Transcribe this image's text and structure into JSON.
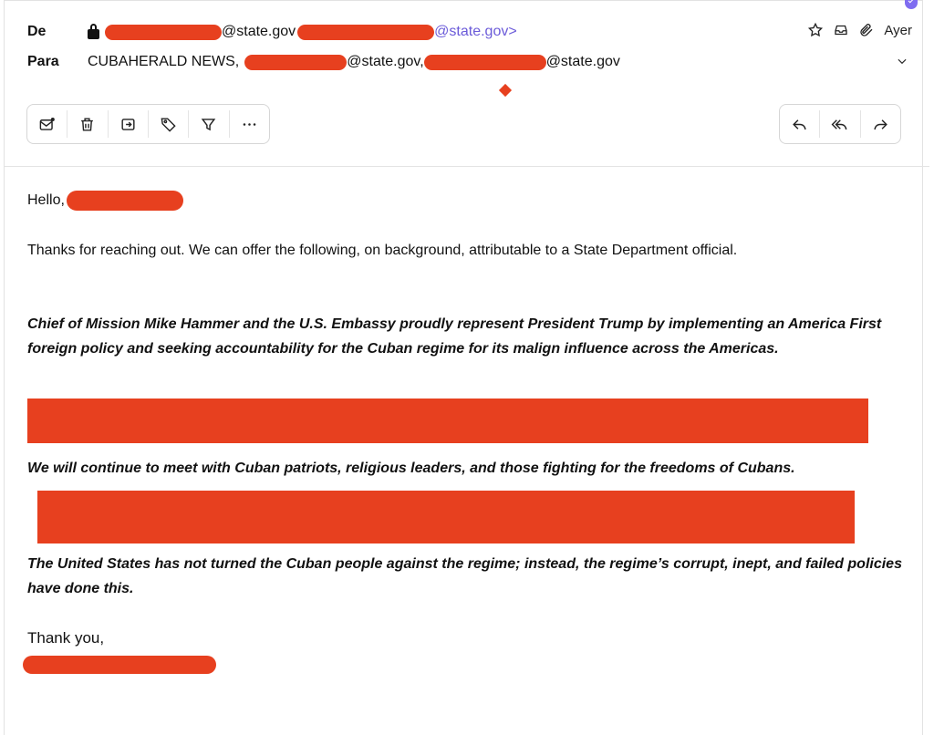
{
  "header": {
    "from_label": "De",
    "from_addr_domain": "@state.gov",
    "from_addr_link": "@state.gov>",
    "to_label": "Para",
    "to_first": "CUBAHERALD NEWS,",
    "to_addr2": "@state.gov,",
    "to_addr3": "@state.gov",
    "date": "Ayer"
  },
  "toolbar": {
    "left_actions": [
      "mark-unread",
      "delete",
      "move",
      "label",
      "filter",
      "more"
    ],
    "right_actions": [
      "reply",
      "reply-all",
      "forward"
    ]
  },
  "message": {
    "greeting": "Hello,",
    "intro": "Thanks for reaching out.  We can offer the following, on background, attributable to a State Department official.",
    "para1": "Chief of Mission Mike Hammer and the U.S. Embassy proudly represent President Trump by implementing an America First foreign policy and seeking accountability for the Cuban regime for its malign influence across the Americas.",
    "para2": "We will continue to meet with Cuban patriots, religious leaders, and those fighting for the freedoms of Cubans.",
    "para3": "The United States has not turned the Cuban people against the regime; instead, the regime’s corrupt, inept, and failed policies have done this.",
    "closing": "Thank you,"
  },
  "colors": {
    "redaction": "#e7401f",
    "link": "#6b5bd9",
    "shield": "#7f6cf0"
  }
}
